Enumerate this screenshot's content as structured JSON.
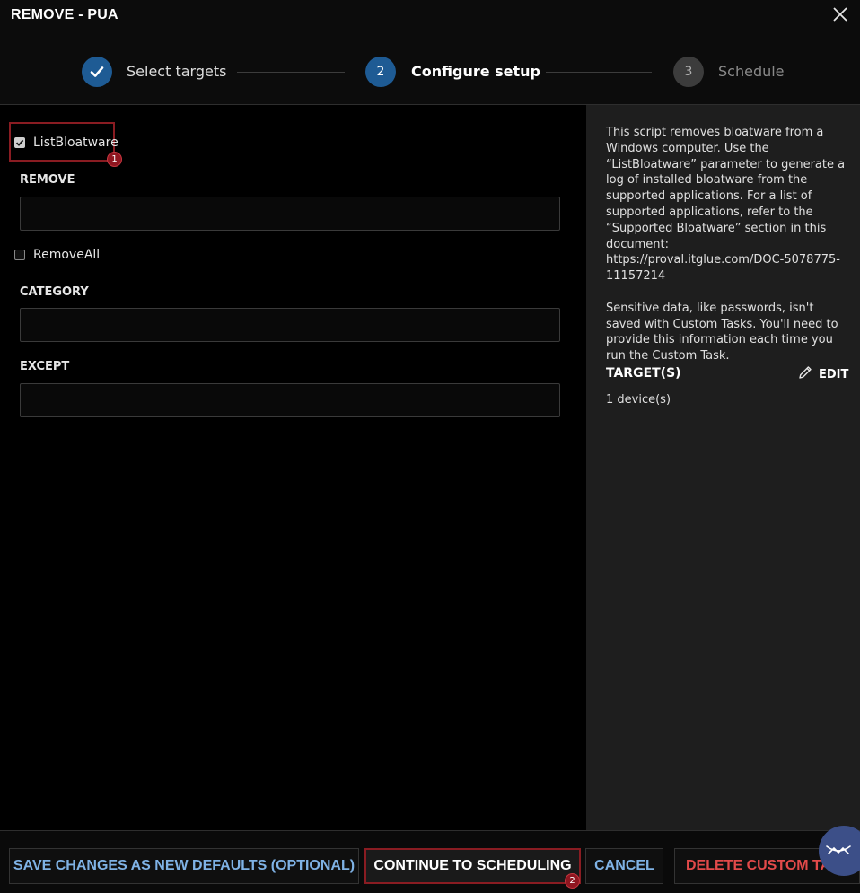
{
  "window": {
    "title": "REMOVE - PUA"
  },
  "stepper": {
    "steps": [
      {
        "number": "",
        "label": "Select targets",
        "state": "done"
      },
      {
        "number": "2",
        "label": "Configure setup",
        "state": "active"
      },
      {
        "number": "3",
        "label": "Schedule",
        "state": "pending"
      }
    ]
  },
  "form": {
    "list_bloatware": {
      "label": "ListBloatware",
      "checked": true,
      "annotation": "1"
    },
    "remove": {
      "label": "REMOVE",
      "value": ""
    },
    "remove_all": {
      "label": "RemoveAll",
      "checked": false
    },
    "category": {
      "label": "CATEGORY",
      "value": ""
    },
    "except": {
      "label": "EXCEPT",
      "value": ""
    }
  },
  "sidebar": {
    "description_p1": "This script removes bloatware from a Windows computer. Use the “ListBloatware” parameter to generate a log of installed bloatware from the supported applications. For a list of supported applications, refer to the “Supported Bloatware” section in this document: https://proval.itglue.com/DOC-5078775-11157214",
    "description_p2": "Sensitive data, like passwords, isn't saved with Custom Tasks. You'll need to provide this information each time you run the Custom Task.",
    "targets_label": "TARGET(S)",
    "edit_label": "EDIT",
    "device_count": "1 device(s)"
  },
  "footer": {
    "save_defaults": "SAVE CHANGES AS NEW DEFAULTS (OPTIONAL)",
    "continue": "CONTINUE TO SCHEDULING",
    "continue_annotation": "2",
    "cancel": "CANCEL",
    "delete": "DELETE CUSTOM TA"
  },
  "colors": {
    "accent_blue": "#1e5b94",
    "link_blue": "#7fb2e5",
    "danger_red": "#e34a4a",
    "highlight_red": "#8a1c22"
  }
}
